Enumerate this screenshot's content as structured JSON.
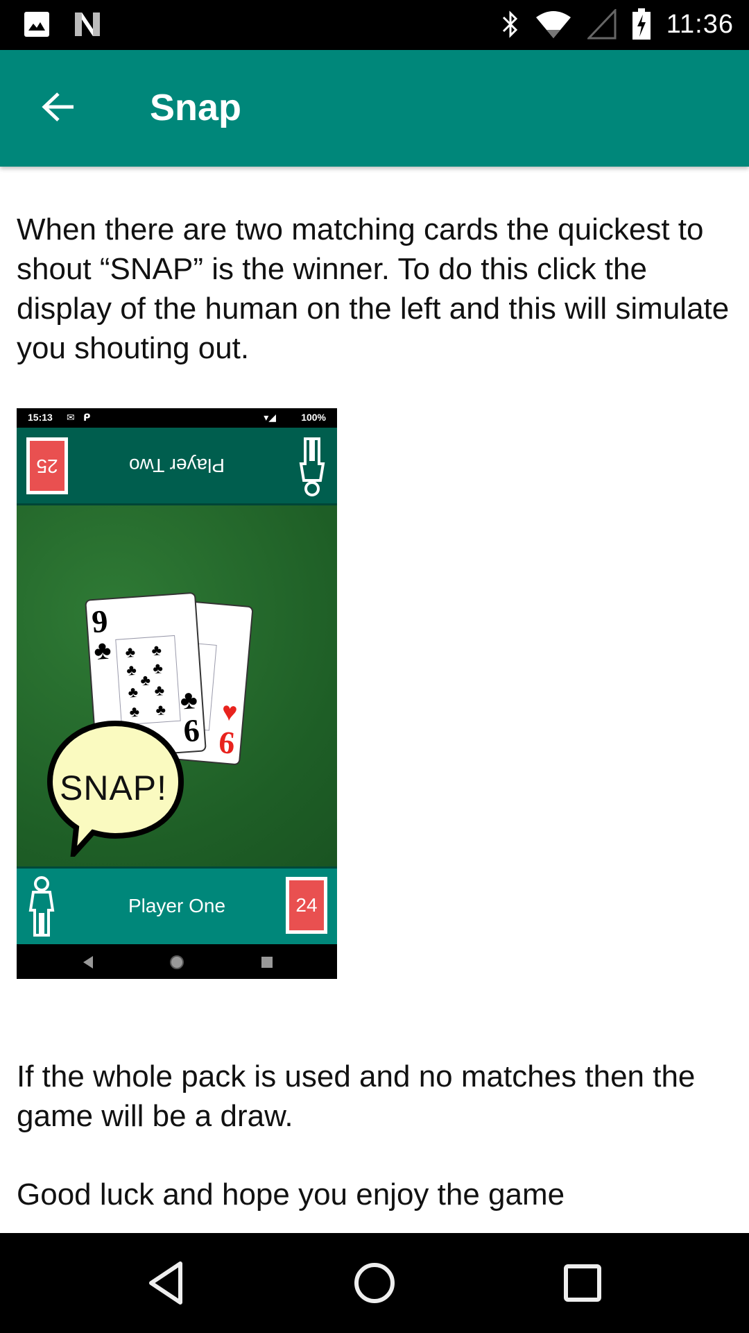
{
  "status_bar": {
    "time": "11:36",
    "left_icons": [
      "gallery-icon",
      "n-icon"
    ],
    "right_icons": [
      "bluetooth-icon",
      "wifi-icon",
      "signal-icon",
      "battery-charging-icon"
    ]
  },
  "app_bar": {
    "title": "Snap",
    "back_icon": "arrow-back-icon",
    "background": "#00877a"
  },
  "content": {
    "paragraph_1": "When there are two matching cards the quickest to shout “SNAP” is the winner. To do this click the display of the human on the left and this will simulate you shouting out.",
    "paragraph_2": "If the whole pack is used and no matches then the game will be a draw.",
    "paragraph_3": "Good luck and hope you enjoy the game"
  },
  "example_screenshot": {
    "status_time": "15:13",
    "status_battery": "100%",
    "player_two": {
      "label": "Player Two",
      "card_count": "25"
    },
    "player_one": {
      "label": "Player One",
      "card_count": "24"
    },
    "card_front": {
      "rank": "9",
      "bottom_rank": "6",
      "suit": "♣"
    },
    "card_back": {
      "rank": "6",
      "suit": "♥"
    },
    "speech_bubble": "SNAP!",
    "colors": {
      "table": "#1e5e26",
      "player_two_bar": "#005e4e",
      "player_one_bar": "#00877a",
      "card_count_bg": "#e95050"
    }
  },
  "nav_bar": {
    "back": "back-triangle-icon",
    "home": "home-circle-icon",
    "recents": "recents-square-icon"
  }
}
